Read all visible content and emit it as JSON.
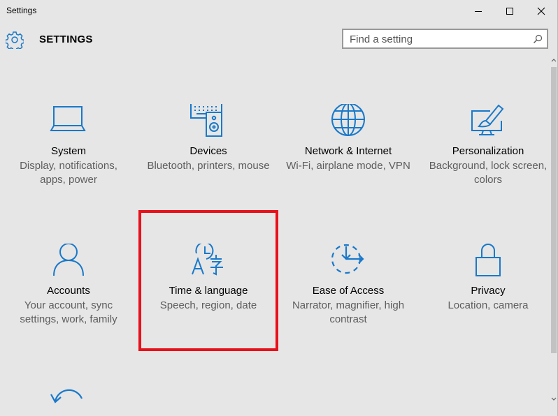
{
  "window": {
    "title": "Settings"
  },
  "header": {
    "title": "SETTINGS",
    "search_placeholder": "Find a setting"
  },
  "colors": {
    "accent": "#1979ca",
    "highlight": "#e8101a"
  },
  "tiles": [
    {
      "name": "System",
      "desc": "Display, notifications, apps, power",
      "icon": "laptop-icon"
    },
    {
      "name": "Devices",
      "desc": "Bluetooth, printers, mouse",
      "icon": "devices-icon"
    },
    {
      "name": "Network & Internet",
      "desc": "Wi-Fi, airplane mode, VPN",
      "icon": "globe-icon"
    },
    {
      "name": "Personalization",
      "desc": "Background, lock screen, colors",
      "icon": "paint-icon"
    },
    {
      "name": "Accounts",
      "desc": "Your account, sync settings, work, family",
      "icon": "person-icon"
    },
    {
      "name": "Time & language",
      "desc": "Speech, region, date",
      "icon": "time-language-icon",
      "highlighted": true
    },
    {
      "name": "Ease of Access",
      "desc": "Narrator, magnifier, high contrast",
      "icon": "ease-of-access-icon"
    },
    {
      "name": "Privacy",
      "desc": "Location, camera",
      "icon": "lock-icon"
    },
    {
      "name": "",
      "desc": "",
      "icon": "update-icon"
    }
  ]
}
